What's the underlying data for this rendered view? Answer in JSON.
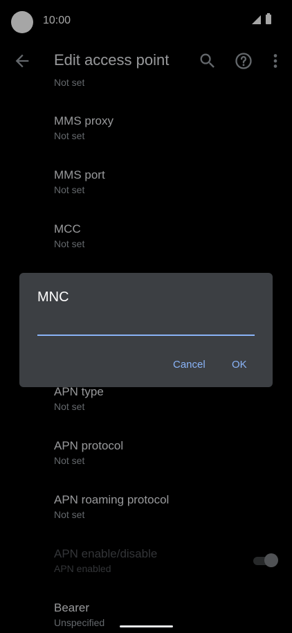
{
  "status_bar": {
    "time": "10:00"
  },
  "toolbar": {
    "title": "Edit access point",
    "icons": [
      "arrow-back-icon",
      "search-icon",
      "help-icon",
      "more-vert-icon"
    ]
  },
  "list": {
    "partial_sub": "Not set",
    "items": [
      {
        "title": "MMS proxy",
        "sub": "Not set"
      },
      {
        "title": "MMS port",
        "sub": "Not set"
      },
      {
        "title": "MCC",
        "sub": "Not set"
      },
      {
        "title": "APN type",
        "sub": "Not set"
      },
      {
        "title": "APN protocol",
        "sub": "Not set"
      },
      {
        "title": "APN roaming protocol",
        "sub": "Not set"
      },
      {
        "title": "APN enable/disable",
        "sub": "APN enabled"
      },
      {
        "title": "Bearer",
        "sub": "Unspecified"
      }
    ]
  },
  "dialog": {
    "title": "MNC",
    "input_value": "",
    "cancel_label": "Cancel",
    "ok_label": "OK"
  },
  "colors": {
    "accent": "#8ab4f8",
    "dialog_bg": "#3c3f43",
    "background": "#000000"
  }
}
